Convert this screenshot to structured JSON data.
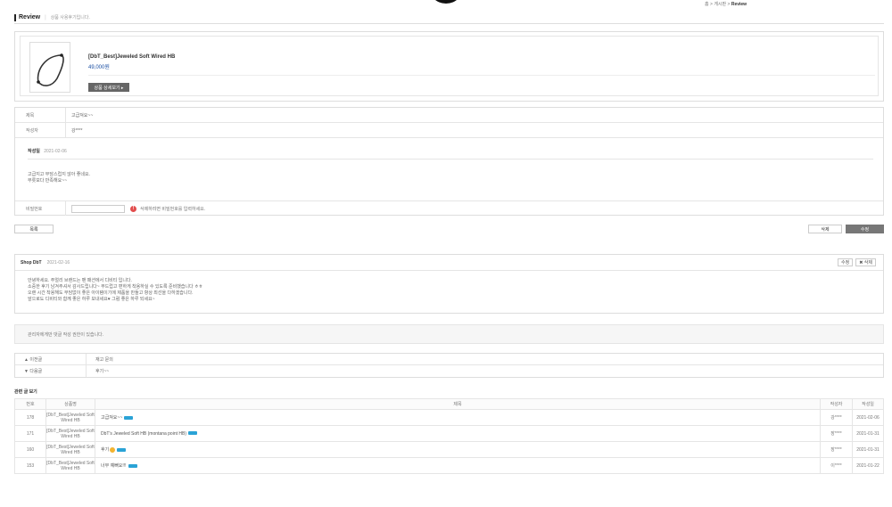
{
  "breadcrumb": {
    "home": "홈",
    "sep1": ">",
    "board": "게시판",
    "sep2": ">",
    "current": "Review"
  },
  "page": {
    "title": "Review",
    "subtitle": "상품 사용후기입니다."
  },
  "product": {
    "name": "[DbT_Best]Jeweled Soft Wired HB",
    "price": "49,000원",
    "detail_button": "상품 상세보기 ▸"
  },
  "post": {
    "title_label": "제목",
    "title_value": "고급져요~~",
    "author_label": "작성자",
    "author_value": "강****",
    "date_label": "작성일",
    "date_value": "2021-02-06",
    "body_lines": [
      "고급지고 부담스럽지 않아 좋네요.",
      "무릇보다 만족해요~~"
    ],
    "password_label": "비밀번호",
    "password_note": "삭제하려면 비밀번호를 입력하세요."
  },
  "actions": {
    "list": "목록",
    "delete": "삭제",
    "edit": "수정"
  },
  "comment": {
    "author": "Shop DbT",
    "date": "2021-02-16",
    "edit_btn": "수정",
    "delete_btn": "✖ 삭제",
    "lines": [
      "안녕하세요. 주얼리 브랜드는 팬 패션에서 디비티 입니다.",
      "소중한 후기 남겨주셔서 감사드립니다~ 부드럽고 편하게 착용하실 수 있도록 준비했습니다 ㅎㅎ",
      "오랜 시간 착용해도 부담없이 좋은 아이템이기에 제품을 만들고 항상 최선을 다하겠습니다.",
      "앞으로도 디비티와 함께 좋은 하루 보내세요♥ 그럼 좋은 하루 되세요~"
    ]
  },
  "notice": "관리자에게만 댓글 작성 권한이 있습니다.",
  "nav": {
    "prev_label": "▲ 이전글",
    "prev_value": "재고 문의",
    "next_label": "▼ 다음글",
    "next_value": "후기~~"
  },
  "related": {
    "title": "관련 글 보기",
    "headers": [
      "번호",
      "상품명",
      "제목",
      "작성자",
      "작성일"
    ],
    "rows": [
      {
        "no": "178",
        "product": "[DbT_Best]Jeweled Soft Wired HB",
        "title": "고급져요~~",
        "author": "강****",
        "date": "2021-02-06"
      },
      {
        "no": "171",
        "product": "[DbT_Best]Jeweled Soft Wired HB",
        "title": "DbT's Jeweled Soft HB (montana point HB)",
        "author": "장****",
        "date": "2021-01-31"
      },
      {
        "no": "160",
        "product": "[DbT_Best]Jeweled Soft Wired HB",
        "title": "후기",
        "author": "장****",
        "date": "2021-01-31"
      },
      {
        "no": "153",
        "product": "[DbT_Best]Jeweled Soft Wired HB",
        "title": "너무 예뻐요!!!",
        "author": "이****",
        "date": "2021-01-22"
      }
    ]
  }
}
